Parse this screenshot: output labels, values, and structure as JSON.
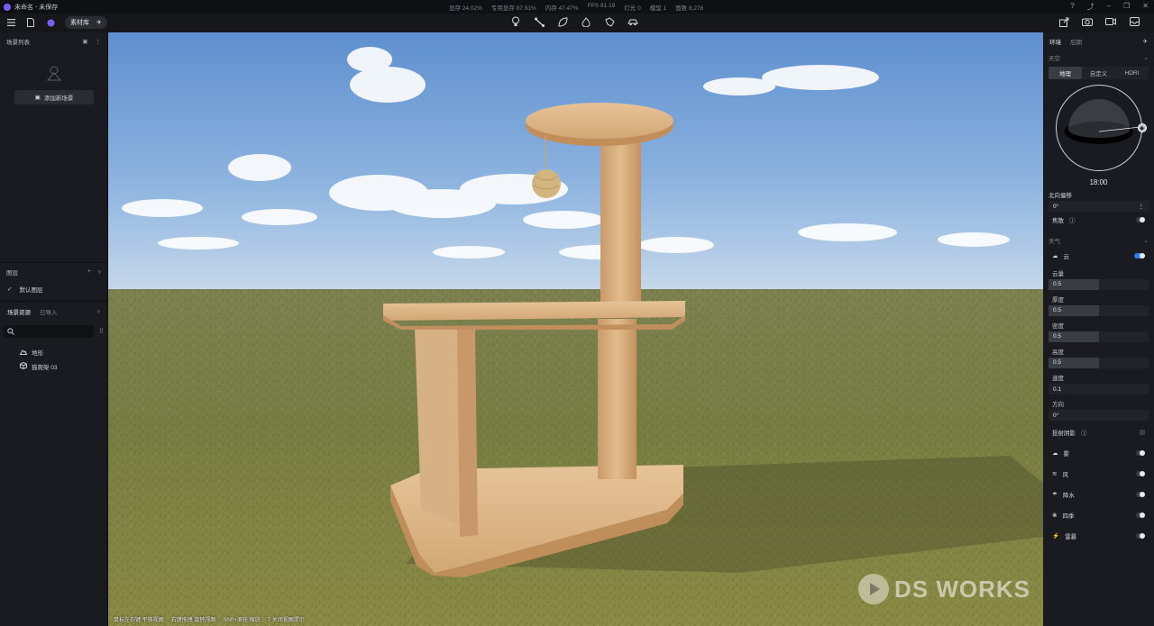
{
  "titlebar": {
    "title": "未命名 - 未保存",
    "stats": [
      "显存 24.02%",
      "专用显存 87.91%",
      "内存 47.47%",
      "FPS 81.19",
      "灯光 0",
      "模型 1",
      "面数 8,276"
    ]
  },
  "toolbar": {
    "library_label": "素材库"
  },
  "left": {
    "scene_list_title": "场景列表",
    "add_scene_label": "添加新场景",
    "layers_title": "图层",
    "default_layer": "默认图层",
    "assets_tab": "场景资源",
    "imported_tab": "已导入",
    "search_placeholder": "",
    "assets": [
      "地形",
      "猫爬架 03"
    ]
  },
  "viewport": {
    "hints": [
      "鼠标左右键 平移视图",
      "右键拖拽 旋转视图",
      "Shift+滚轮 缩放",
      "T 关闭视图提示"
    ],
    "watermark": "DS WORKS"
  },
  "right": {
    "tab_env": "环境",
    "tab_effect": "后期",
    "sky_title": "天空",
    "sky_modes": [
      "地理",
      "自定义",
      "HDRI"
    ],
    "time": "18:00",
    "north_label": "北向偏移",
    "north_value": "0°",
    "focus_label": "焦散",
    "weather_title": "天气",
    "cloud_label": "云",
    "sliders": [
      {
        "label": "云量",
        "value": "0.5",
        "fraction": 0.5
      },
      {
        "label": "厚度",
        "value": "0.5",
        "fraction": 0.5
      },
      {
        "label": "密度",
        "value": "0.5",
        "fraction": 0.5
      },
      {
        "label": "高度",
        "value": "0.5",
        "fraction": 0.5
      }
    ],
    "speed_label": "速度",
    "speed_value": "0.1",
    "direction_label": "方向",
    "direction_value": "0°",
    "cast_shadow_label": "投射阴影",
    "effects": [
      "雾",
      "风",
      "降水",
      "四季",
      "雷暴"
    ]
  },
  "colors": {
    "accent": "#2f7cf6",
    "logo": "#7b5cf5"
  }
}
